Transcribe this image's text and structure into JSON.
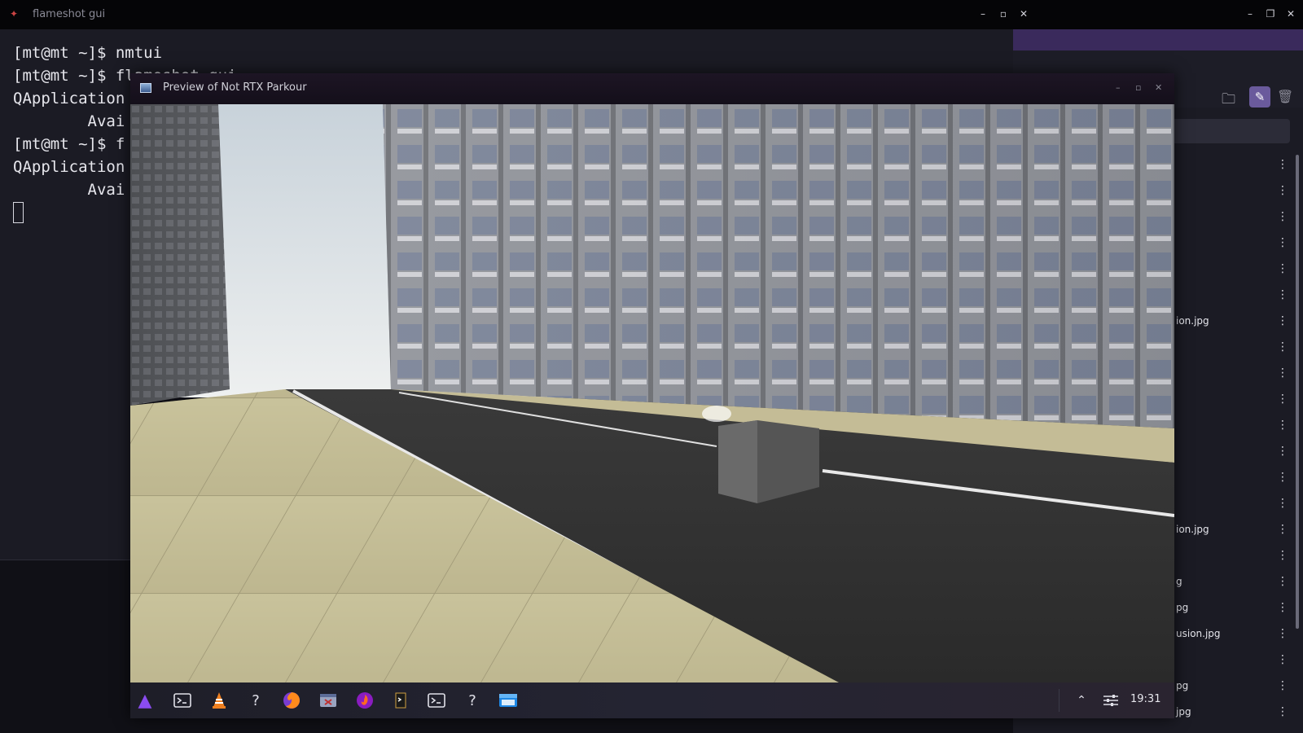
{
  "terminal_window": {
    "title": "flameshot gui",
    "lines": [
      "[mt@mt ~]$ nmtui",
      "[mt@mt ~]$ flameshot gui",
      "QApplication",
      "        Avai",
      "[mt@mt ~]$ f",
      "QApplication",
      "        Avai"
    ]
  },
  "preview_window": {
    "title": "Preview of Not RTX Parkour"
  },
  "file_panel": {
    "files": [
      {
        "label": ""
      },
      {
        "label": ""
      },
      {
        "label": ""
      },
      {
        "label": ""
      },
      {
        "label": ""
      },
      {
        "label": ""
      },
      {
        "label": "ion.jpg"
      },
      {
        "label": ""
      },
      {
        "label": ""
      },
      {
        "label": ""
      },
      {
        "label": ""
      },
      {
        "label": ""
      },
      {
        "label": ""
      },
      {
        "label": ""
      },
      {
        "label": "ion.jpg"
      },
      {
        "label": ""
      },
      {
        "label": "g"
      },
      {
        "label": "pg"
      },
      {
        "label": "usion.jpg"
      },
      {
        "label": ""
      },
      {
        "label": "pg"
      },
      {
        "label": "jpg"
      }
    ]
  },
  "taskbar": {
    "apps": [
      {
        "name": "app-launcher-icon"
      },
      {
        "name": "terminal-icon"
      },
      {
        "name": "vlc-icon"
      },
      {
        "name": "unknown-app-icon"
      },
      {
        "name": "firefox-icon"
      },
      {
        "name": "window-app-icon"
      },
      {
        "name": "firefox-dev-icon"
      },
      {
        "name": "game-icon"
      },
      {
        "name": "terminal-icon-2"
      },
      {
        "name": "unknown-app-icon-2"
      },
      {
        "name": "file-manager-icon"
      }
    ],
    "clock": "19:31"
  },
  "colors": {
    "accent_purple": "#3a2a5c",
    "terminal_bg": "#1b1b24",
    "active_edit": "#6a5a9c"
  }
}
